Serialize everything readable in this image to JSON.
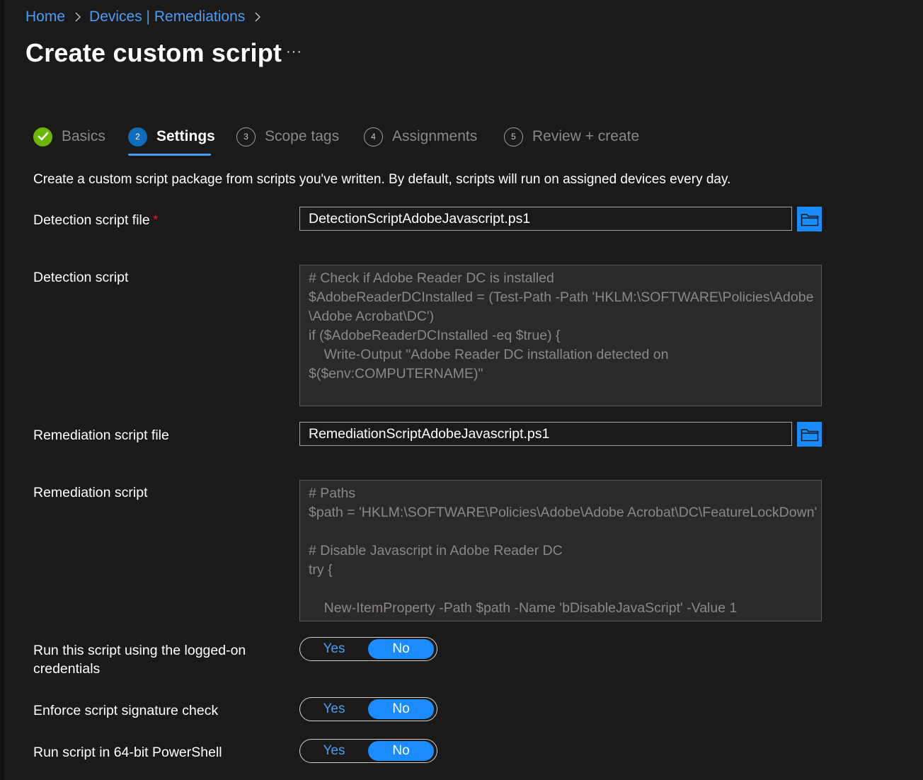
{
  "breadcrumb": {
    "home": "Home",
    "section": "Devices | Remediations"
  },
  "page": {
    "title": "Create custom script",
    "more": "···"
  },
  "steps": [
    {
      "number": "1",
      "label": "Basics",
      "state": "completed"
    },
    {
      "number": "2",
      "label": "Settings",
      "state": "current"
    },
    {
      "number": "3",
      "label": "Scope tags",
      "state": "pending"
    },
    {
      "number": "4",
      "label": "Assignments",
      "state": "pending"
    },
    {
      "number": "5",
      "label": "Review + create",
      "state": "pending"
    }
  ],
  "intro": "Create a custom script package from scripts you've written. By default, scripts will run on assigned devices every day.",
  "detection_file": {
    "label": "Detection script file",
    "required_mark": "*",
    "value": "DetectionScriptAdobeJavascript.ps1"
  },
  "detection_script": {
    "label": "Detection script",
    "lines": [
      "# Check if Adobe Reader DC is installed",
      "$AdobeReaderDCInstalled = (Test-Path -Path 'HKLM:\\SOFTWARE\\Policies\\Adobe",
      "\\Adobe Acrobat\\DC')",
      "if ($AdobeReaderDCInstalled -eq $true) {",
      "    Write-Output \"Adobe Reader DC installation detected on",
      "$($env:COMPUTERNAME)\""
    ]
  },
  "remediation_file": {
    "label": "Remediation script file",
    "value": "RemediationScriptAdobeJavascript.ps1"
  },
  "remediation_script": {
    "label": "Remediation script",
    "lines": [
      "# Paths",
      "$path = 'HKLM:\\SOFTWARE\\Policies\\Adobe\\Adobe Acrobat\\DC\\FeatureLockDown'",
      "",
      "# Disable Javascript in Adobe Reader DC",
      "try {",
      "",
      "    New-ItemProperty -Path $path -Name 'bDisableJavaScript' -Value 1"
    ]
  },
  "options": [
    {
      "label_line1": "Run this script using the logged-on",
      "label_line2": "credentials",
      "yes": "Yes",
      "no": "No",
      "selected": "No"
    },
    {
      "label_line1": "Enforce script signature check",
      "label_line2": "",
      "yes": "Yes",
      "no": "No",
      "selected": "No"
    },
    {
      "label_line1": "Run script in 64-bit PowerShell",
      "label_line2": "",
      "yes": "Yes",
      "no": "No",
      "selected": "No"
    }
  ],
  "colors": {
    "accent": "#1a8cff",
    "link": "#479ef5",
    "success": "#6bb700",
    "required": "#e81123",
    "background": "#1b1a19"
  },
  "icons": {
    "completed_step": "checkmark-icon",
    "browse": "folder-icon",
    "breadcrumb_separator": "chevron-right-icon"
  }
}
